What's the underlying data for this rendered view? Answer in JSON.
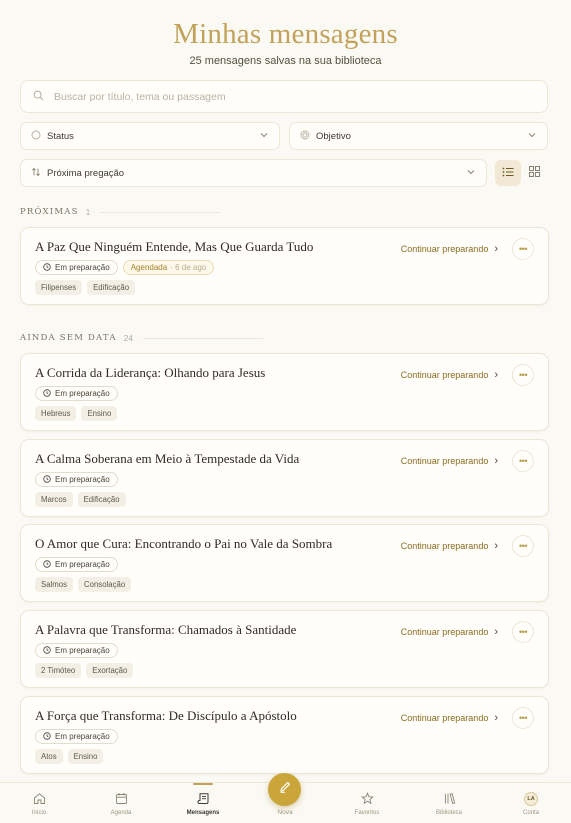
{
  "header": {
    "title": "Minhas mensagens",
    "subtitle": "25 mensagens salvas na sua biblioteca"
  },
  "search": {
    "placeholder": "Buscar por título, tema ou passagem"
  },
  "filters": {
    "status": "Status",
    "objective": "Objetivo",
    "sort": "Próxima pregação"
  },
  "view": {
    "active": "list"
  },
  "sections": {
    "upcoming": {
      "label": "PRÓXIMAS",
      "count": "1"
    },
    "undated": {
      "label": "AINDA SEM DATA",
      "count": "24"
    }
  },
  "cards": [
    {
      "title": "A Paz Que Ninguém Entende, Mas Que Guarda Tudo",
      "status": "Em preparação",
      "scheduled": "Agendada",
      "scheduled_when": "· 6 de ago",
      "tags": [
        "Filipenses",
        "Edificação"
      ],
      "action": "Continuar preparando"
    },
    {
      "title": "A Corrida da Liderança: Olhando para Jesus",
      "status": "Em preparação",
      "tags": [
        "Hebreus",
        "Ensino"
      ],
      "action": "Continuar preparando"
    },
    {
      "title": "A Calma Soberana em Meio à Tempestade da Vida",
      "status": "Em preparação",
      "tags": [
        "Marcos",
        "Edificação"
      ],
      "action": "Continuar preparando"
    },
    {
      "title": "O Amor que Cura: Encontrando o Pai no Vale da Sombra",
      "status": "Em preparação",
      "tags": [
        "Salmos",
        "Consolação"
      ],
      "action": "Continuar preparando"
    },
    {
      "title": "A Palavra que Transforma: Chamados à Santidade",
      "status": "Em preparação",
      "tags": [
        "2 Timóteo",
        "Exortação"
      ],
      "action": "Continuar preparando"
    },
    {
      "title": "A Força que Transforma: De Discípulo a Apóstolo",
      "status": "Em preparação",
      "tags": [
        "Atos",
        "Ensino"
      ],
      "action": "Continuar preparando"
    }
  ],
  "tabbar": {
    "inicio": "Início",
    "agenda": "Agenda",
    "mensagens": "Mensagens",
    "nova": "Nova",
    "favoritos": "Favoritos",
    "biblioteca": "Biblioteca",
    "conta": "Conta",
    "avatar_initials": "LA",
    "active": "mensagens"
  },
  "colors": {
    "accent": "#c2a25a",
    "background": "#fbf9f3",
    "fab": "#c9a53a"
  }
}
